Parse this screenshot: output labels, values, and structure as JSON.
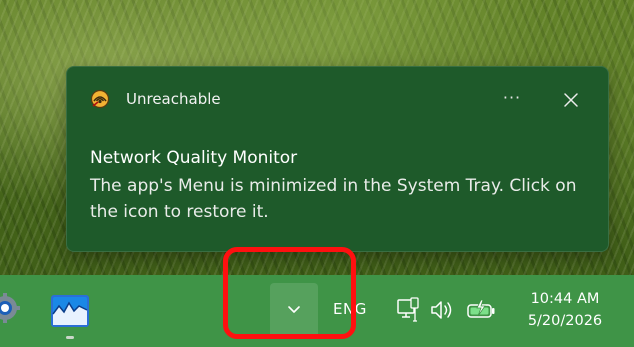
{
  "notification": {
    "app_name": "Unreachable",
    "app_icon": "network-monitor-icon",
    "more_label": "···",
    "title": "Network Quality Monitor",
    "body": "The app's Menu is minimized in the System Tray. Click on the icon to restore it."
  },
  "taskbar": {
    "apps": [
      "settings-gear-icon",
      "network-quality-monitor-app-icon"
    ],
    "tray_overflow_icon": "chevron-down-icon",
    "language": "ENG",
    "tray_icons": [
      "network-icon",
      "volume-icon",
      "battery-charging-icon"
    ],
    "time": "10:44 AM",
    "date": "5/20/2026"
  },
  "colors": {
    "toast_background": "#1e5a2a",
    "taskbar_background": "#3f9447",
    "highlight": "#ff1010"
  }
}
